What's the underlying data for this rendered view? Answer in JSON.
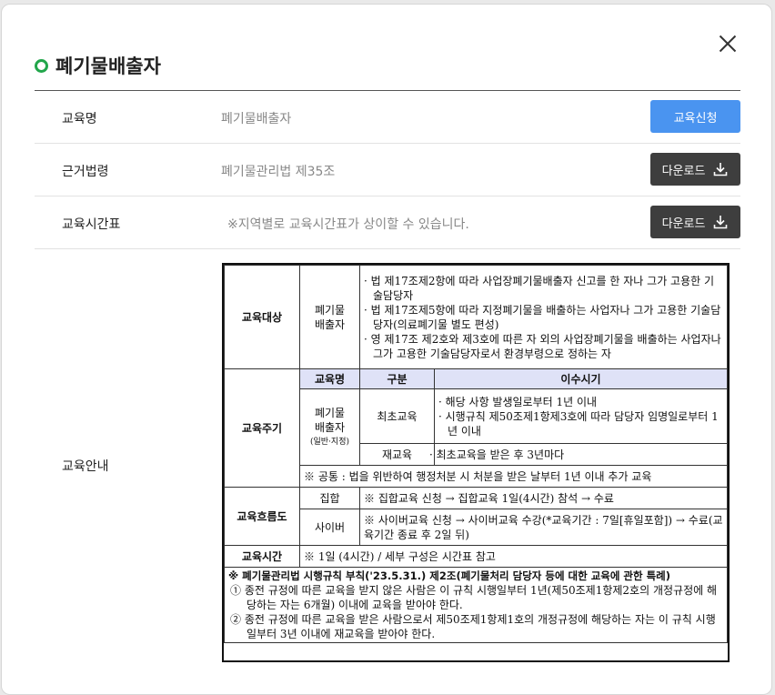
{
  "title": "폐기물배출자",
  "rows": {
    "course": {
      "label": "교육명",
      "value": "폐기물배출자",
      "button": "교육신청"
    },
    "law": {
      "label": "근거법령",
      "value": "폐기물관리법 제35조",
      "button": "다운로드"
    },
    "schedule": {
      "label": "교육시간표",
      "value": "※지역별로 교육시간표가 상이할 수 있습니다.",
      "button": "다운로드"
    },
    "guide": {
      "label": "교육안내"
    }
  },
  "doc": {
    "target": {
      "head": "교육대상",
      "category": "폐기물\n배출자",
      "items": [
        "· 법 제17조제2항에 따라 사업장폐기물배출자 신고를 한 자나 그가 고용한 기술담당자",
        "· 법 제17조제5항에 따라 지정폐기물을 배출하는 사업자나 그가 고용한 기술담당자(의료폐기물 별도 편성)",
        "· 영 제17조 제2호와 제3호에 따른 자 외의 사업장폐기물을 배출하는 사업자나 그가 고용한 기술담당자로서 환경부령으로 정하는 자"
      ]
    },
    "cycle": {
      "head": "교육주기",
      "col_course": "교육명",
      "col_type": "구분",
      "col_period": "이수시기",
      "course_name": "폐기물\n배출자",
      "course_sub": "(일반·지정)",
      "first_label": "최초교육",
      "first_items": [
        "· 해당 사항 발생일로부터 1년 이내",
        "· 시행규칙 제50조제1항제3호에 따라 담당자 임명일로부터 1년 이내"
      ],
      "re_label": "재교육",
      "re_item": "· 최초교육을 받은 후 3년마다",
      "common": "※ 공통 : 법을 위반하여 행정처분 시 처분을 받은 날부터 1년 이내 추가 교육"
    },
    "flow": {
      "head": "교육흐름도",
      "group_label": "집합",
      "group_text": "※ 집합교육 신청 → 집합교육 1일(4시간) 참석 → 수료",
      "cyber_label": "사이버",
      "cyber_text": "※ 사이버교육 신청 → 사이버교육 수강(*교육기간 : 7일[휴일포함]) → 수료(교육기간 종료 후 2일 뒤)"
    },
    "time": {
      "head": "교육시간",
      "text": "※ 1일 (4시간) / 세부 구성은 시간표 참고"
    },
    "note": {
      "title": "※ 폐기물관리법 시행규칙 부칙('23.5.31.) 제2조(폐기물처리 담당자 등에 대한 교육에 관한 특례)",
      "p1": "① 종전 규정에 따른 교육을 받지 않은 사람은 이 규칙 시행일부터 1년(제50조제1항제2호의 개정규정에 해당하는 자는 6개월) 이내에 교육을 받아야 한다.",
      "p2": "② 종전 규정에 따른 교육을 받은 사람으로서 제50조제1항제1호의 개정규정에 해당하는 자는 이 규칙 시행일부터 3년 이내에 재교육을 받아야 한다."
    }
  }
}
